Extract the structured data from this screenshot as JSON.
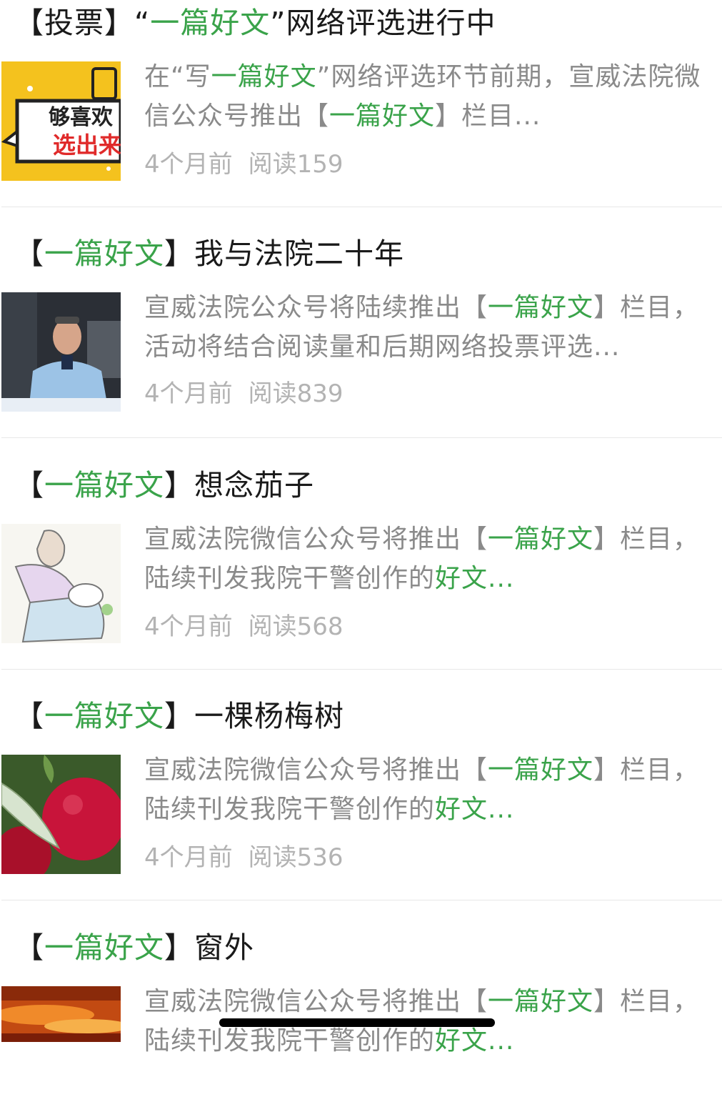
{
  "articles": [
    {
      "title": [
        {
          "text": "【投票】“",
          "hl": false
        },
        {
          "text": "一篇好文",
          "hl": true
        },
        {
          "text": "”网络评选进行中",
          "hl": false
        }
      ],
      "excerpt": [
        {
          "text": "在“写",
          "hl": false
        },
        {
          "text": "一篇好文",
          "hl": true
        },
        {
          "text": "”网络评选环节前期，宣威法院微信公众号推出【",
          "hl": false
        },
        {
          "text": "一篇好文",
          "hl": true
        },
        {
          "text": "】栏目...",
          "hl": false
        }
      ],
      "time": "4个月前",
      "reads": "阅读159",
      "thumb": "poster"
    },
    {
      "title": [
        {
          "text": "【",
          "hl": false
        },
        {
          "text": "一篇好文",
          "hl": true
        },
        {
          "text": "】我与法院二十年",
          "hl": false
        }
      ],
      "excerpt": [
        {
          "text": "宣威法院公众号将陆续推出【",
          "hl": false
        },
        {
          "text": "一篇好文",
          "hl": true
        },
        {
          "text": "】栏目，活动将结合阅读量和后期网络投票评选...",
          "hl": false
        }
      ],
      "time": "4个月前",
      "reads": "阅读839",
      "thumb": "officer"
    },
    {
      "title": [
        {
          "text": "【",
          "hl": false
        },
        {
          "text": "一篇好文",
          "hl": true
        },
        {
          "text": "】想念茄子",
          "hl": false
        }
      ],
      "excerpt": [
        {
          "text": "宣威法院微信公众号将推出【",
          "hl": false
        },
        {
          "text": "一篇好文",
          "hl": true
        },
        {
          "text": "】栏目，陆续刊发我院干警创作的",
          "hl": false
        },
        {
          "text": "好文",
          "hl": true
        },
        {
          "text": "...",
          "hl": false
        }
      ],
      "time": "4个月前",
      "reads": "阅读568",
      "thumb": "sketch"
    },
    {
      "title": [
        {
          "text": "【",
          "hl": false
        },
        {
          "text": "一篇好文",
          "hl": true
        },
        {
          "text": "】一棵杨梅树",
          "hl": false
        }
      ],
      "excerpt": [
        {
          "text": "宣威法院微信公众号将推出【",
          "hl": false
        },
        {
          "text": "一篇好文",
          "hl": true
        },
        {
          "text": "】栏目，陆续刊发我院干警创作的",
          "hl": false
        },
        {
          "text": "好文",
          "hl": true
        },
        {
          "text": "...",
          "hl": false
        }
      ],
      "time": "4个月前",
      "reads": "阅读536",
      "thumb": "bayberry"
    },
    {
      "title": [
        {
          "text": "【",
          "hl": false
        },
        {
          "text": "一篇好文",
          "hl": true
        },
        {
          "text": "】窗外",
          "hl": false
        }
      ],
      "excerpt": [
        {
          "text": "宣威法院微信公众号将推出【",
          "hl": false
        },
        {
          "text": "一篇好文",
          "hl": true
        },
        {
          "text": "】栏目，陆续刊发我院干警创作的",
          "hl": false
        },
        {
          "text": "好文",
          "hl": true
        },
        {
          "text": "...",
          "hl": false
        }
      ],
      "time": "",
      "reads": "",
      "thumb": "sunset"
    }
  ],
  "poster_text": [
    "够喜欢",
    "选出来"
  ],
  "colors": {
    "highlight": "#3aa34a",
    "title": "#1a1a1a",
    "excerpt": "#8a8a8a",
    "meta": "#b3b3b3"
  }
}
